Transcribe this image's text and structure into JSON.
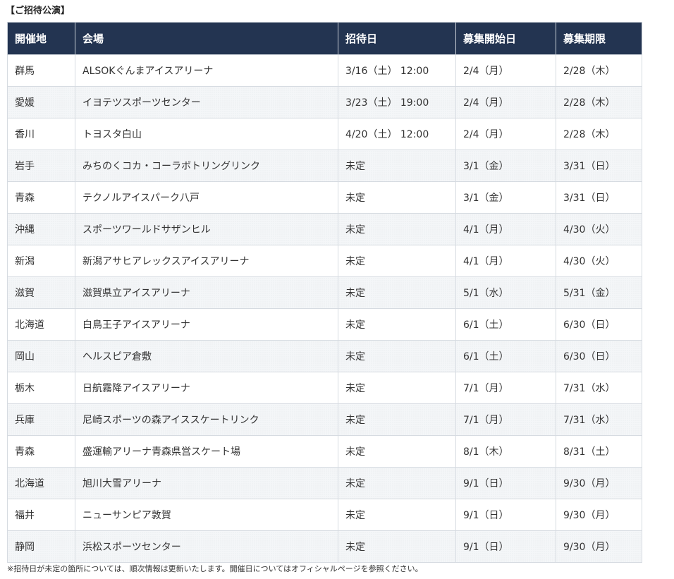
{
  "section_title": "【ご招待公演】",
  "table": {
    "headers": {
      "venue_region": "開催地",
      "venue": "会場",
      "invite_date": "招待日",
      "apply_start": "募集開始日",
      "apply_deadline": "募集期限"
    },
    "rows": [
      {
        "region": "群馬",
        "venue": "ALSOKぐんまアイスアリーナ",
        "invite": "3/16（土） 12:00",
        "start": "2/4（月）",
        "deadline": "2/28（木）"
      },
      {
        "region": "愛媛",
        "venue": "イヨテツスポーツセンター",
        "invite": "3/23（土） 19:00",
        "start": "2/4（月）",
        "deadline": "2/28（木）"
      },
      {
        "region": "香川",
        "venue": "トヨスタ白山",
        "invite": "4/20（土） 12:00",
        "start": "2/4（月）",
        "deadline": "2/28（木）"
      },
      {
        "region": "岩手",
        "venue": "みちのくコカ・コーラボトリングリンク",
        "invite": "未定",
        "start": "3/1（金）",
        "deadline": "3/31（日）"
      },
      {
        "region": "青森",
        "venue": "テクノルアイスパーク八戸",
        "invite": "未定",
        "start": "3/1（金）",
        "deadline": "3/31（日）"
      },
      {
        "region": "沖縄",
        "venue": "スポーツワールドサザンヒル",
        "invite": "未定",
        "start": "4/1（月）",
        "deadline": "4/30（火）"
      },
      {
        "region": "新潟",
        "venue": "新潟アサヒアレックスアイスアリーナ",
        "invite": "未定",
        "start": "4/1（月）",
        "deadline": "4/30（火）"
      },
      {
        "region": "滋賀",
        "venue": "滋賀県立アイスアリーナ",
        "invite": "未定",
        "start": "5/1（水）",
        "deadline": "5/31（金）"
      },
      {
        "region": "北海道",
        "venue": "白鳥王子アイスアリーナ",
        "invite": "未定",
        "start": "6/1（土）",
        "deadline": "6/30（日）"
      },
      {
        "region": "岡山",
        "venue": "ヘルスピア倉敷",
        "invite": "未定",
        "start": "6/1（土）",
        "deadline": "6/30（日）"
      },
      {
        "region": "栃木",
        "venue": "日航霧降アイスアリーナ",
        "invite": "未定",
        "start": "7/1（月）",
        "deadline": "7/31（水）"
      },
      {
        "region": "兵庫",
        "venue": "尼崎スポーツの森アイススケートリンク",
        "invite": "未定",
        "start": "7/1（月）",
        "deadline": "7/31（水）"
      },
      {
        "region": "青森",
        "venue": "盛運輸アリーナ青森県営スケート場",
        "invite": "未定",
        "start": "8/1（木）",
        "deadline": "8/31（土）"
      },
      {
        "region": "北海道",
        "venue": "旭川大雪アリーナ",
        "invite": "未定",
        "start": "9/1（日）",
        "deadline": "9/30（月）"
      },
      {
        "region": "福井",
        "venue": "ニューサンピア敦賀",
        "invite": "未定",
        "start": "9/1（日）",
        "deadline": "9/30（月）"
      },
      {
        "region": "静岡",
        "venue": "浜松スポーツセンター",
        "invite": "未定",
        "start": "9/1（日）",
        "deadline": "9/30（月）"
      }
    ]
  },
  "footnote": "※招待日が未定の箇所については、順次情報は更新いたします。開催日についてはオフィシャルページを参照ください。"
}
